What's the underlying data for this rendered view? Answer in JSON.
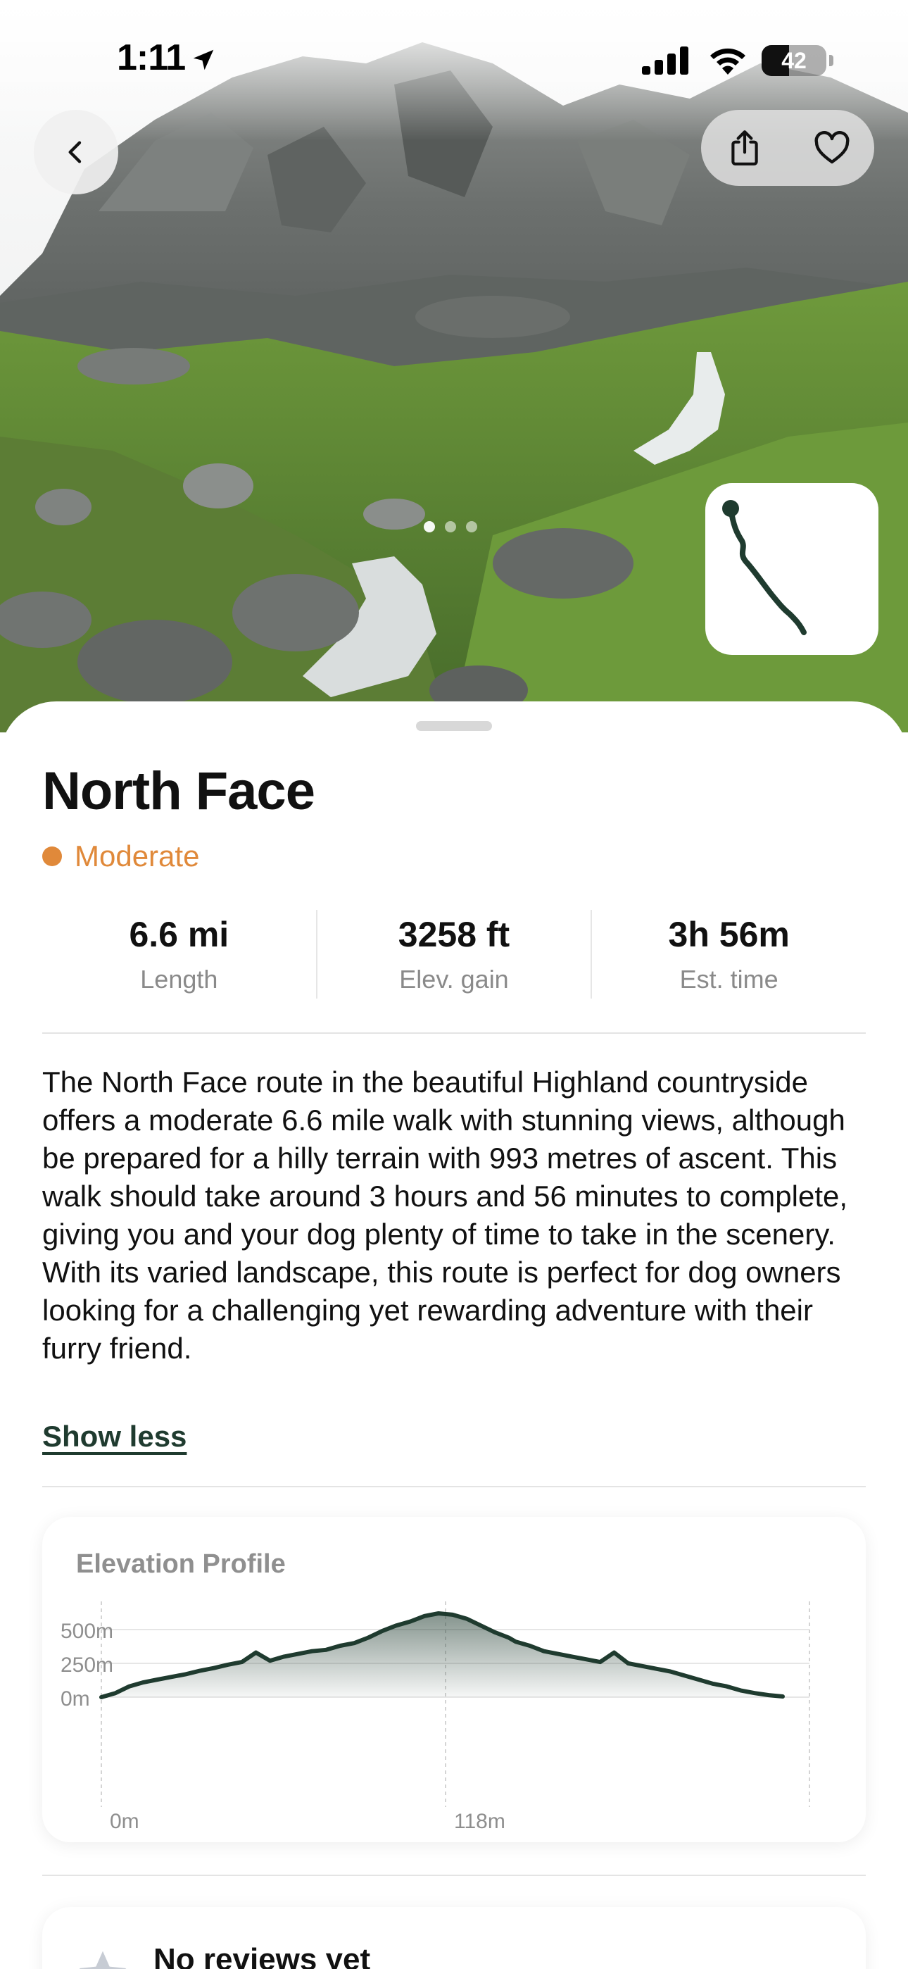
{
  "status_bar": {
    "time": "1:11",
    "battery_level": "42",
    "battery_fraction": 0.42,
    "icons": [
      "location-arrow-icon",
      "cellular-signal-icon",
      "wifi-icon",
      "battery-icon"
    ]
  },
  "header": {
    "back_icon": "chevron-left-icon",
    "share_icon": "share-icon",
    "favorite_icon": "heart-icon"
  },
  "gallery": {
    "page_count": 3,
    "active_index": 0
  },
  "route": {
    "title": "North Face",
    "difficulty": "Moderate",
    "difficulty_color": "#E0893A",
    "route_color": "#1F3B2F"
  },
  "stats": [
    {
      "value": "6.6 mi",
      "label": "Length"
    },
    {
      "value": "3258 ft",
      "label": "Elev. gain"
    },
    {
      "value": "3h 56m",
      "label": "Est. time"
    }
  ],
  "description": {
    "text": "The North Face route in the beautiful Highland countryside offers a moderate 6.6 mile walk with stunning views, although be prepared for a hilly terrain with 993 metres of ascent. This walk should take around 3 hours and 56 minutes to complete, giving you and your dog plenty of time to take in the scenery. With its varied landscape, this route is perfect for dog owners looking for a challenging yet rewarding adventure with their furry friend.",
    "toggle_label": "Show less"
  },
  "elevation": {
    "title": "Elevation Profile",
    "y_ticks": [
      "500m",
      "250m",
      "0m"
    ],
    "x_ticks": [
      "0m",
      "118m"
    ]
  },
  "chart_data": {
    "type": "area",
    "title": "Elevation Profile",
    "x": [
      0,
      4,
      8,
      12,
      16,
      20,
      24,
      28,
      32,
      36,
      40,
      44,
      48,
      52,
      56,
      60,
      64,
      68,
      72,
      76,
      80,
      84,
      88,
      92,
      96,
      100,
      104,
      108,
      112,
      116,
      118,
      122,
      126,
      130,
      134,
      138,
      142,
      146,
      150,
      154,
      158,
      162,
      166,
      170,
      174,
      178,
      182,
      186,
      190,
      194,
      198,
      202,
      206,
      210,
      214,
      218,
      222,
      226,
      230,
      234,
      236
    ],
    "values": [
      0,
      30,
      80,
      110,
      130,
      150,
      170,
      195,
      215,
      240,
      260,
      330,
      270,
      300,
      320,
      340,
      350,
      380,
      400,
      440,
      490,
      530,
      560,
      600,
      620,
      610,
      580,
      530,
      480,
      440,
      410,
      380,
      340,
      320,
      300,
      280,
      260,
      330,
      250,
      230,
      210,
      190,
      160,
      130,
      100,
      80,
      50,
      30,
      15,
      5,
      0,
      0,
      0,
      0,
      0,
      0,
      0,
      0,
      0,
      0,
      0
    ],
    "x_tick_labels": [
      "0m",
      "118m"
    ],
    "y_tick_labels": [
      "500m",
      "250m",
      "0m"
    ],
    "ylim": [
      0,
      650
    ],
    "grid": true,
    "series_color": "#1F3B2F"
  },
  "reviews": {
    "title": "No reviews yet",
    "star_icon": "star-icon"
  }
}
